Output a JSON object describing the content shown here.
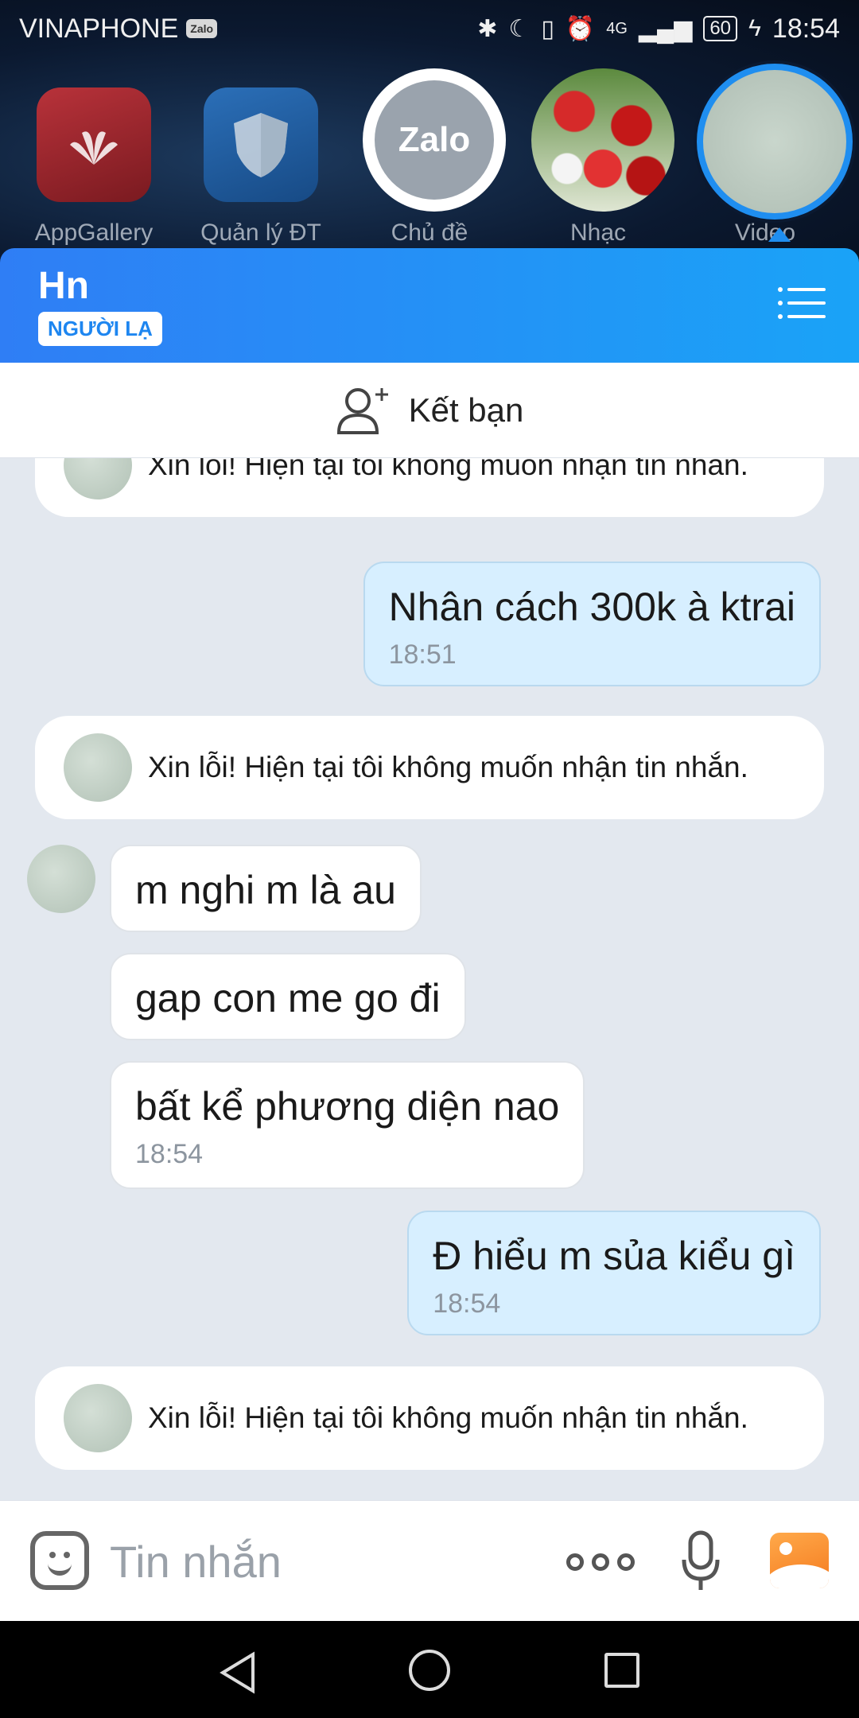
{
  "status_bar": {
    "carrier": "VINAPHONE",
    "carrier_badge": "Zalo",
    "network": "4G",
    "battery": "60",
    "time": "18:54"
  },
  "home_apps": [
    {
      "label": "AppGallery"
    },
    {
      "label": "Quản lý ĐT"
    },
    {
      "label": "Chủ đề"
    },
    {
      "label": "Nhạc"
    },
    {
      "label": "Video"
    }
  ],
  "chat_heads": {
    "zalo_label": "Zalo"
  },
  "header": {
    "title": "Hn",
    "badge": "NGƯỜI LẠ",
    "accent_start": "#2f7ef5",
    "accent_end": "#1aa3f7"
  },
  "add_friend": {
    "label": "Kết bạn"
  },
  "messages": {
    "system_1": "Xin lỗi! Hiện tại tôi không muốn nhận tin nhắn.",
    "out_1": {
      "text": "Nhân cách 300k à ktrai",
      "time": "18:51"
    },
    "system_2": "Xin lỗi! Hiện tại tôi không muốn nhận tin nhắn.",
    "in_1": {
      "text": "m nghi m là au"
    },
    "in_2": {
      "text": "gap con me go đi"
    },
    "in_3": {
      "text": "bất kể phương diện nao",
      "time": "18:54"
    },
    "out_2": {
      "text": "Đ hiểu m sủa kiểu gì",
      "time": "18:54"
    },
    "system_3": "Xin lỗi! Hiện tại tôi không muốn nhận tin nhắn."
  },
  "input_bar": {
    "placeholder": "Tin nhắn"
  },
  "icons": {
    "menu": "menu-icon",
    "add_friend": "add-user-icon",
    "emoji": "sticker-icon",
    "more": "more-icon",
    "mic": "microphone-icon",
    "image": "image-icon"
  }
}
